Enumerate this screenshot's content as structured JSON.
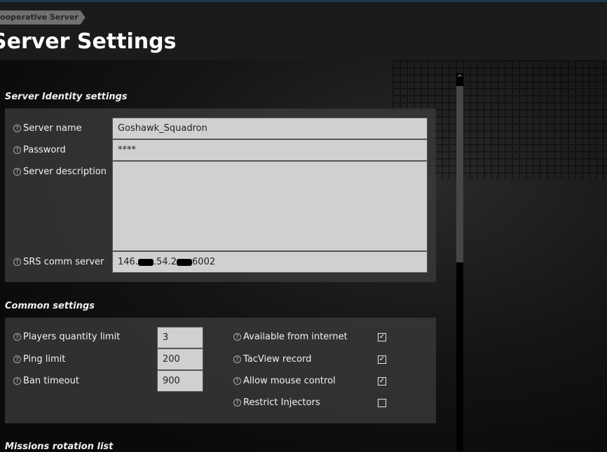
{
  "breadcrumb": "Cooperative Server",
  "page_title": "Server Settings",
  "identity": {
    "title": "Server Identity settings",
    "server_name_label": "Server name",
    "server_name": "Goshawk_Squadron",
    "password_label": "Password",
    "password": "****",
    "description_label": "Server description",
    "description": "",
    "srs_label": "SRS comm server",
    "srs_a": "146.",
    "srs_b": ".54.2",
    "srs_c": "6002"
  },
  "common": {
    "title": "Common settings",
    "players_label": "Players quantity limit",
    "players": "3",
    "ping_label": "Ping limit",
    "ping": "200",
    "ban_label": "Ban timeout",
    "ban": "900",
    "internet_label": "Available from internet",
    "internet": true,
    "tacview_label": "TacView record",
    "tacview": true,
    "mouse_label": "Allow mouse control",
    "mouse": true,
    "injectors_label": "Restrict Injectors",
    "injectors": false
  },
  "missions": {
    "title": "Missions rotation list"
  },
  "help_glyph": "?",
  "check_glyph": "✓",
  "scroll_up_glyph": "^"
}
